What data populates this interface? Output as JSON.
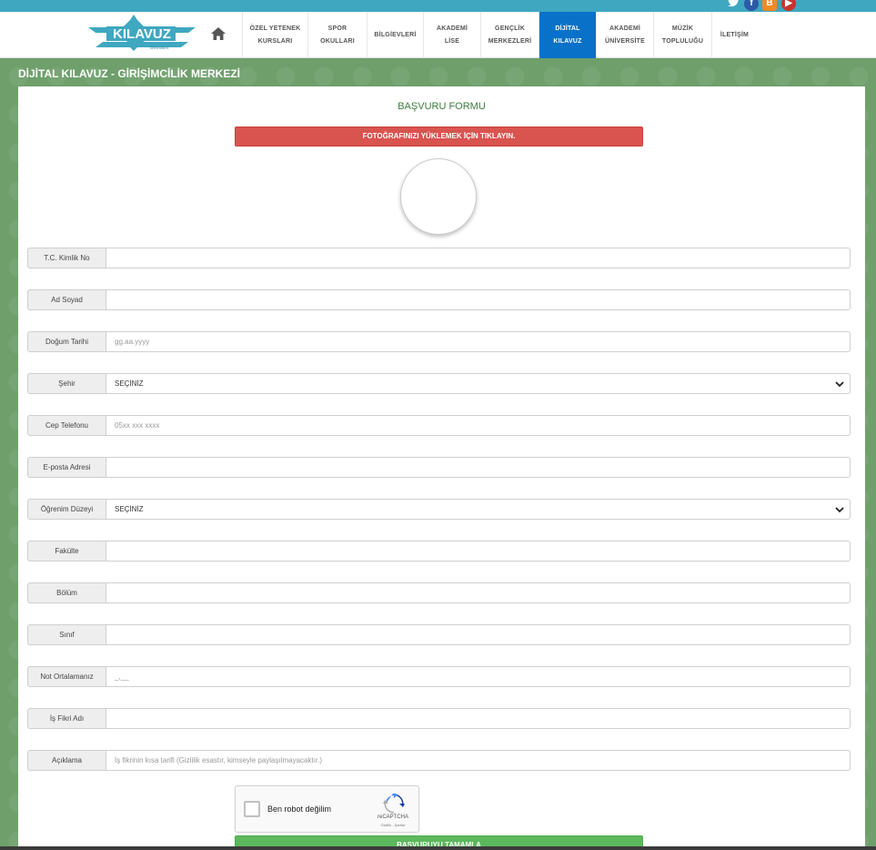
{
  "colors": {
    "topbar": "#3fa7c0",
    "nav_active": "#0a71c9",
    "background": "#6f9f6b",
    "upload_button": "#d9534f",
    "submit_button": "#5cb85c"
  },
  "social": [
    {
      "icon": "twitter-icon",
      "glyph": "🐦"
    },
    {
      "icon": "facebook-icon",
      "glyph": "f"
    },
    {
      "icon": "blogger-icon",
      "glyph": "B"
    },
    {
      "icon": "youtube-icon",
      "glyph": "▶"
    }
  ],
  "logo": {
    "text": "KILAVUZ",
    "tagline": "DERSHANESİ"
  },
  "nav": {
    "home_icon": "home-icon",
    "items": [
      {
        "label": "ÖZEL YETENEK\nKURSLARI",
        "active": false
      },
      {
        "label": "SPOR\nOKULLARI",
        "active": false
      },
      {
        "label": "BİLGİEVLERİ",
        "active": false
      },
      {
        "label": "AKADEMİ\nLİSE",
        "active": false
      },
      {
        "label": "GENÇLİK\nMERKEZLERİ",
        "active": false
      },
      {
        "label": "DİJİTAL\nKILAVUZ",
        "active": true
      },
      {
        "label": "AKADEMİ\nÜNİVERSİTE",
        "active": false
      },
      {
        "label": "MÜZİK\nTOPLULUĞU",
        "active": false
      },
      {
        "label": "İLETİŞİM",
        "active": false
      }
    ]
  },
  "page_title": "DİJİTAL KILAVUZ - GİRİŞİMCİLİK MERKEZİ",
  "form": {
    "title": "BAŞVURU FORMU",
    "upload_label": "FOTOĞRAFINIZI YÜKLEMEK İÇİN TIKLAYIN.",
    "fields": [
      {
        "label": "T.C. Kimlik No",
        "type": "text",
        "value": "",
        "placeholder": ""
      },
      {
        "label": "Ad Soyad",
        "type": "text",
        "value": "",
        "placeholder": ""
      },
      {
        "label": "Doğum Tarihi",
        "type": "text",
        "value": "",
        "placeholder": "gg.aa.yyyy"
      },
      {
        "label": "Şehir",
        "type": "select",
        "value": "SEÇİNİZ",
        "placeholder": ""
      },
      {
        "label": "Cep Telefonu",
        "type": "text",
        "value": "",
        "placeholder": "05xx xxx xxxx"
      },
      {
        "label": "E-posta Adresi",
        "type": "text",
        "value": "",
        "placeholder": ""
      },
      {
        "label": "Öğrenim Düzeyi",
        "type": "select",
        "value": "SEÇİNİZ",
        "placeholder": ""
      },
      {
        "label": "Fakülte",
        "type": "text",
        "value": "",
        "placeholder": ""
      },
      {
        "label": "Bölüm",
        "type": "text",
        "value": "",
        "placeholder": ""
      },
      {
        "label": "Sınıf",
        "type": "text",
        "value": "",
        "placeholder": ""
      },
      {
        "label": "Not Ortalamanız",
        "type": "text",
        "value": "",
        "placeholder": "_,__"
      },
      {
        "label": "İş Fikri Adı",
        "type": "text",
        "value": "",
        "placeholder": ""
      },
      {
        "label": "Açıklama",
        "type": "text",
        "value": "",
        "placeholder": "İş fikrinin kısa tarifi (Gizlilik esastır, kimseyle paylaşılmayacaktır.)"
      }
    ],
    "captcha": {
      "label": "Ben robot değilim",
      "brand": "reCAPTCHA",
      "terms": "Gizlilik - Şartlar"
    },
    "submit_label": "BAŞVURUYU TAMAMLA"
  }
}
